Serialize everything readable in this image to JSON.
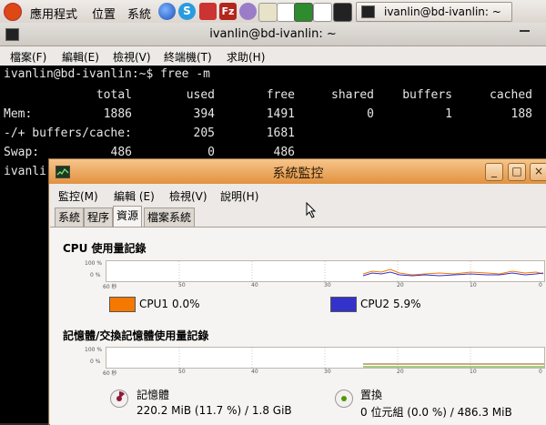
{
  "panel": {
    "menus": [
      "應用程式",
      "位置",
      "系統"
    ],
    "task_title": "ivanlin@bd-ivanlin: ~"
  },
  "terminal": {
    "title": "ivanlin@bd-ivanlin: ~",
    "menus": [
      "檔案(F)",
      "編輯(E)",
      "檢視(V)",
      "終端機(T)",
      "求助(H)"
    ],
    "prompt1": "ivanlin@bd-ivanlin:~$ free -m",
    "headers": [
      "total",
      "used",
      "free",
      "shared",
      "buffers",
      "cached"
    ],
    "mem": {
      "label": "Mem:",
      "values": [
        "1886",
        "394",
        "1491",
        "0",
        "1",
        "188"
      ]
    },
    "buffers": {
      "label": "-/+ buffers/cache:",
      "values": [
        "205",
        "1681"
      ]
    },
    "swap": {
      "label": "Swap:",
      "values": [
        "486",
        "0",
        "486"
      ]
    },
    "prompt2": "ivanli"
  },
  "monitor": {
    "title": "系統監控",
    "menus": [
      "監控(M)",
      "編輯 (E)",
      "檢視(V)",
      "說明(H)"
    ],
    "tabs": [
      "系統",
      "程序",
      "資源",
      "檔案系統"
    ],
    "active_tab": 2,
    "cpu": {
      "heading": "CPU 使用量記錄",
      "y_labels": [
        "100 %",
        "0 %"
      ],
      "x_labels": [
        "60 秒",
        "50",
        "40",
        "30",
        "20",
        "10",
        "0"
      ],
      "cpu1": {
        "label": "CPU1",
        "value": "0.0%",
        "color": "#f57900"
      },
      "cpu2": {
        "label": "CPU2",
        "value": "5.9%",
        "color": "#3333cc"
      }
    },
    "mem": {
      "heading": "記憶體/交換記憶體使用量記錄",
      "y_labels": [
        "100 %",
        "0 %"
      ],
      "x_labels": [
        "60 秒",
        "50",
        "40",
        "30",
        "20",
        "10",
        "0"
      ],
      "memory": {
        "label": "記憶體",
        "value": "220.2 MiB (11.7 %) / 1.8 GiB"
      },
      "swap": {
        "label": "置換",
        "value": "0 位元組 (0.0 %) / 486.3 MiB"
      }
    }
  }
}
